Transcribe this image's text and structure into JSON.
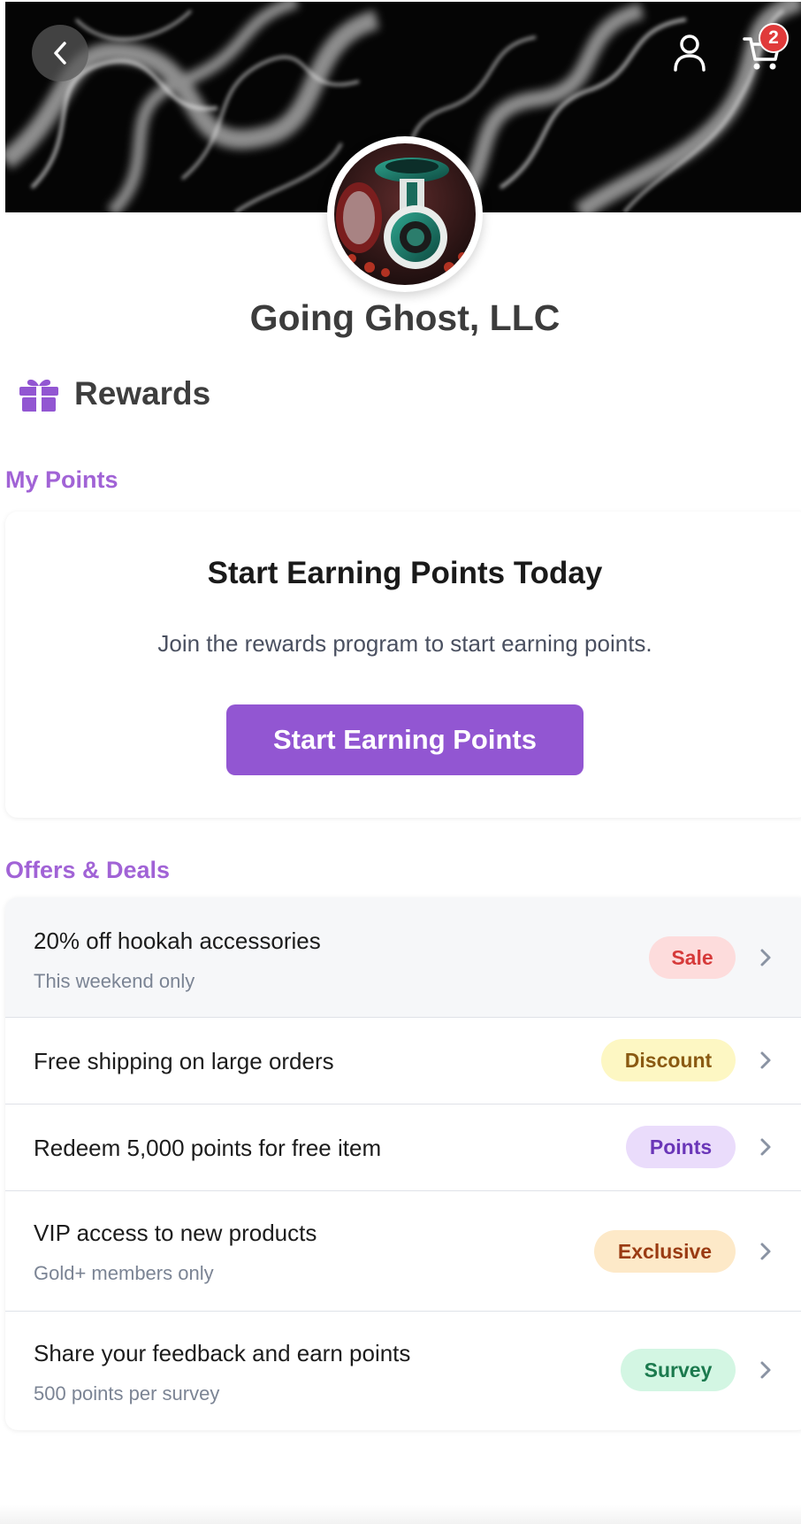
{
  "header": {
    "back_icon": "chevron-left-icon",
    "user_icon": "user-icon",
    "cart_icon": "cart-icon",
    "cart_count": "2"
  },
  "store": {
    "name": "Going Ghost, LLC"
  },
  "rewards": {
    "icon": "gift-icon",
    "title": "Rewards"
  },
  "my_points": {
    "label": "My Points",
    "card_title": "Start Earning Points Today",
    "card_desc": "Join the rewards program to start earning points.",
    "button_label": "Start Earning Points"
  },
  "offers": {
    "label": "Offers & Deals",
    "items": [
      {
        "title": "20% off hookah accessories",
        "subtitle": "This weekend only",
        "badge": "Sale",
        "badge_bg": "#fddcdc",
        "badge_fg": "#d63a3a"
      },
      {
        "title": "Free shipping on large orders",
        "subtitle": "",
        "badge": "Discount",
        "badge_bg": "#fdf7c3",
        "badge_fg": "#8a5a12"
      },
      {
        "title": "Redeem 5,000 points for free item",
        "subtitle": "",
        "badge": "Points",
        "badge_bg": "#eadcfb",
        "badge_fg": "#6a36b8"
      },
      {
        "title": "VIP access to new products",
        "subtitle": "Gold+ members only",
        "badge": "Exclusive",
        "badge_bg": "#fde9c8",
        "badge_fg": "#9a3b12"
      },
      {
        "title": "Share your feedback and earn points",
        "subtitle": "500 points per survey",
        "badge": "Survey",
        "badge_bg": "#d3f6e3",
        "badge_fg": "#1b7a4e"
      }
    ]
  },
  "colors": {
    "accent": "#9256d2",
    "section_label": "#a163d6",
    "badge_red": "#e03a3a"
  }
}
